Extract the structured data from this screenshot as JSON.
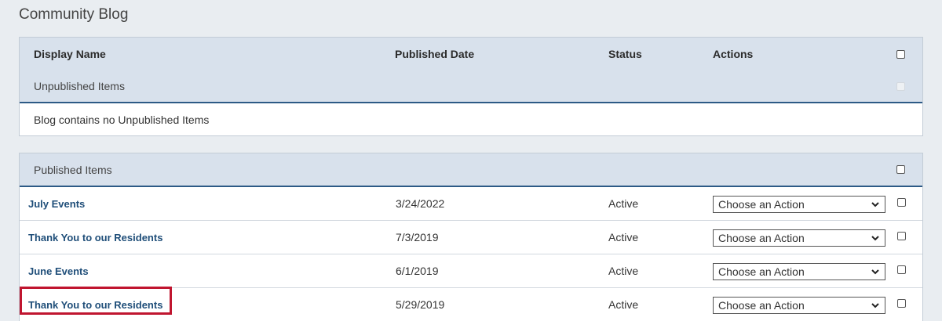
{
  "page": {
    "title": "Community Blog"
  },
  "columns": {
    "display_name": "Display Name",
    "published_date": "Published Date",
    "status": "Status",
    "actions": "Actions"
  },
  "unpublished": {
    "label": "Unpublished Items",
    "empty_message": "Blog contains no Unpublished Items"
  },
  "published": {
    "label": "Published Items",
    "rows": [
      {
        "title": "July Events",
        "date": "3/24/2022",
        "status": "Active",
        "action": "Choose an Action"
      },
      {
        "title": "Thank You to our Residents",
        "date": "7/3/2019",
        "status": "Active",
        "action": "Choose an Action"
      },
      {
        "title": "June Events",
        "date": "6/1/2019",
        "status": "Active",
        "action": "Choose an Action"
      },
      {
        "title": "Thank You to our Residents",
        "date": "5/29/2019",
        "status": "Active",
        "action": "Choose an Action"
      }
    ]
  },
  "colors": {
    "accent": "#2d5a86",
    "link": "#1f4e79",
    "highlight": "#c0152f",
    "header_bg": "#d8e1ec"
  }
}
